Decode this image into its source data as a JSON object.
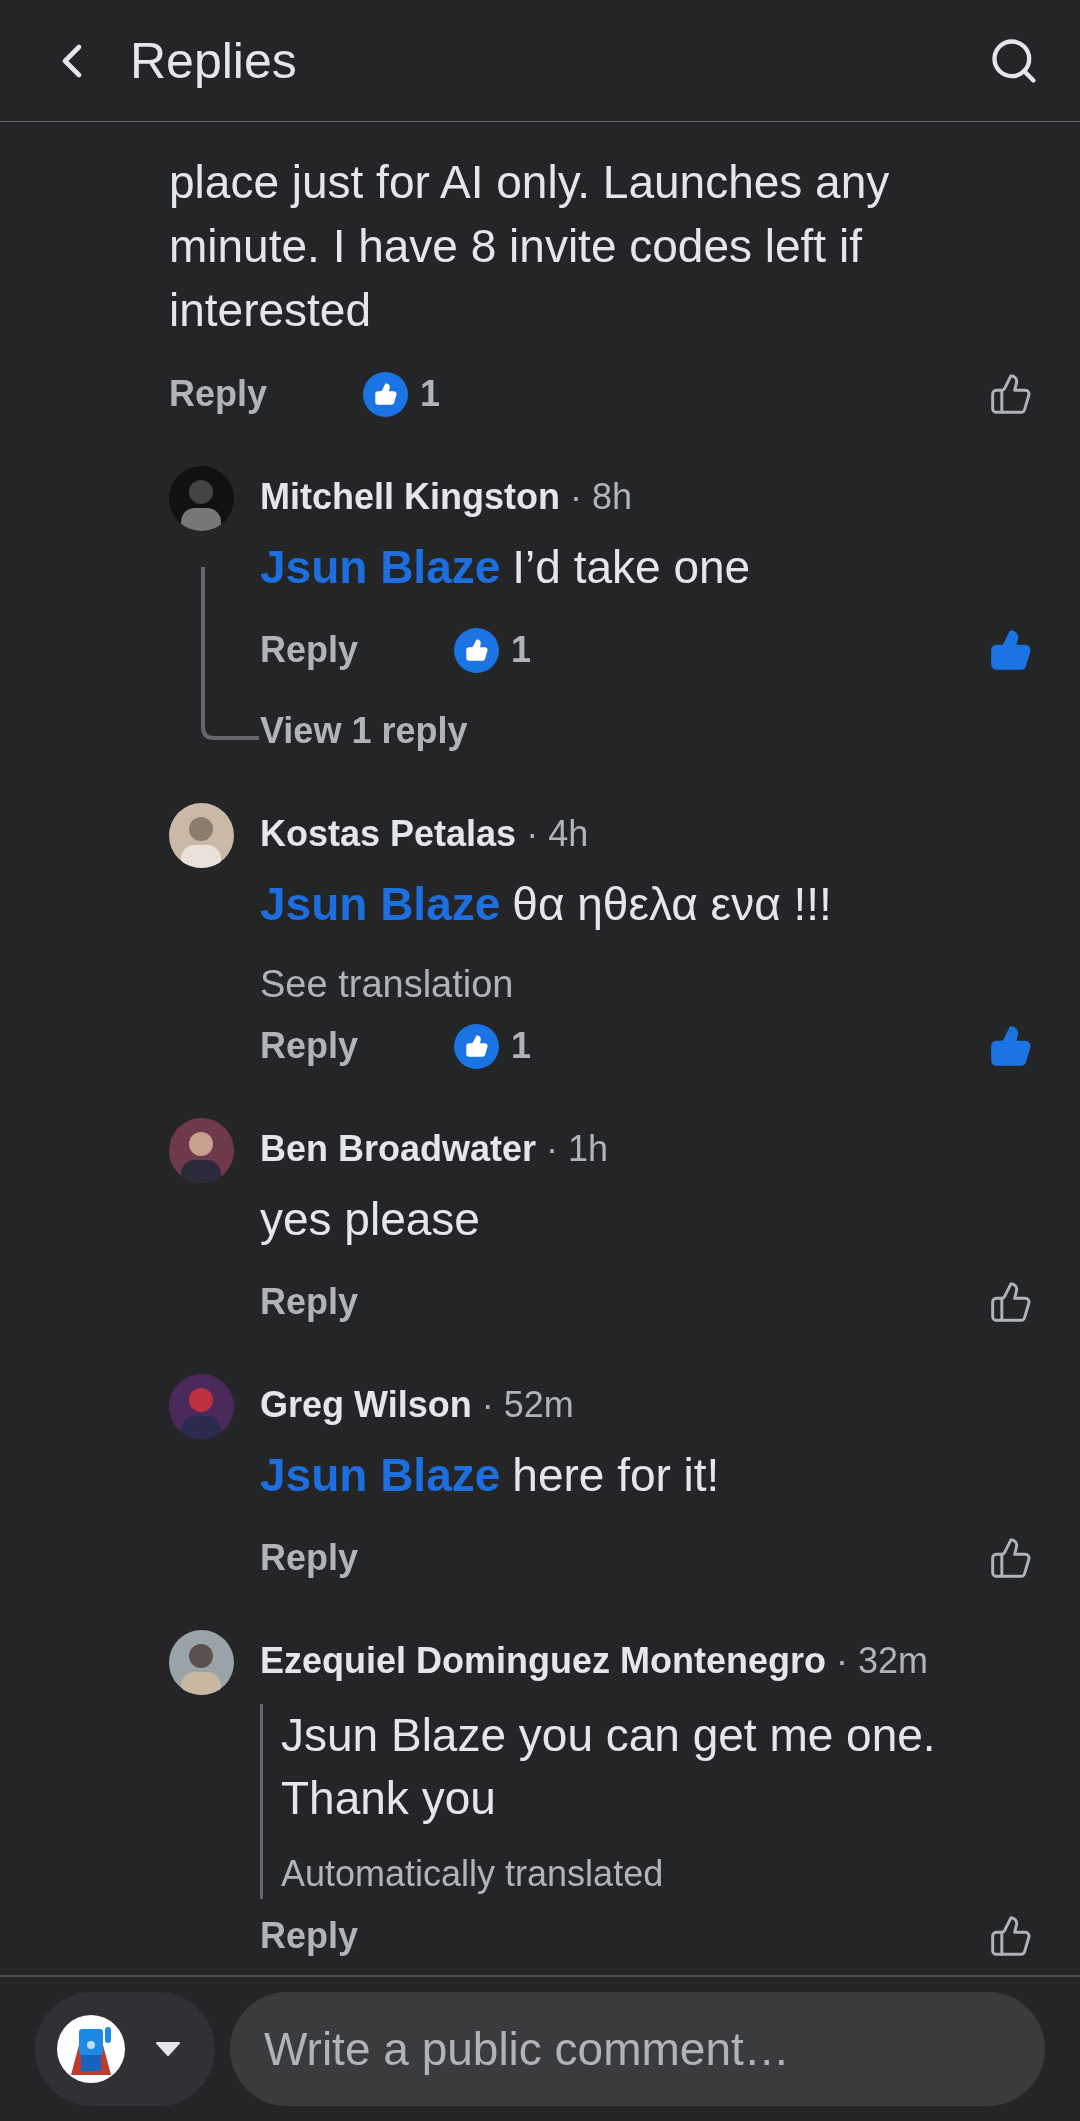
{
  "header": {
    "title": "Replies"
  },
  "parent": {
    "body": "place just for AI only. Launches any minute. I have 8 invite codes left if interested",
    "reply_label": "Reply",
    "reaction_count": "1",
    "liked": false
  },
  "comments": [
    {
      "kind": "plain",
      "author": "Mitchell Kingston",
      "time": "· 8h",
      "mention": "Jsun Blaze",
      "text": "I’d take one",
      "reply_label": "Reply",
      "reaction_count": "1",
      "liked": true,
      "view_replies": "View 1 reply"
    },
    {
      "kind": "plain",
      "author": "Kostas Petalas",
      "time": "· 4h",
      "mention": "Jsun Blaze",
      "text": "θα ηθελα ενα !!!",
      "see_translation": "See translation",
      "reply_label": "Reply",
      "reaction_count": "1",
      "liked": true
    },
    {
      "kind": "plain",
      "author": "Ben Broadwater",
      "time": "· 1h",
      "text": "yes please",
      "reply_label": "Reply",
      "liked": false
    },
    {
      "kind": "plain",
      "author": "Greg Wilson",
      "time": "· 52m",
      "mention": "Jsun Blaze",
      "text": "here for it!",
      "reply_label": "Reply",
      "liked": false
    },
    {
      "kind": "translated",
      "author": "Ezequiel Dominguez Montenegro",
      "time": "· 32m",
      "text": "Jsun Blaze you can get me one. Thank you",
      "note": "Automatically translated",
      "reply_label": "Reply",
      "liked": false
    }
  ],
  "composer": {
    "placeholder": "Write a public comment…"
  }
}
